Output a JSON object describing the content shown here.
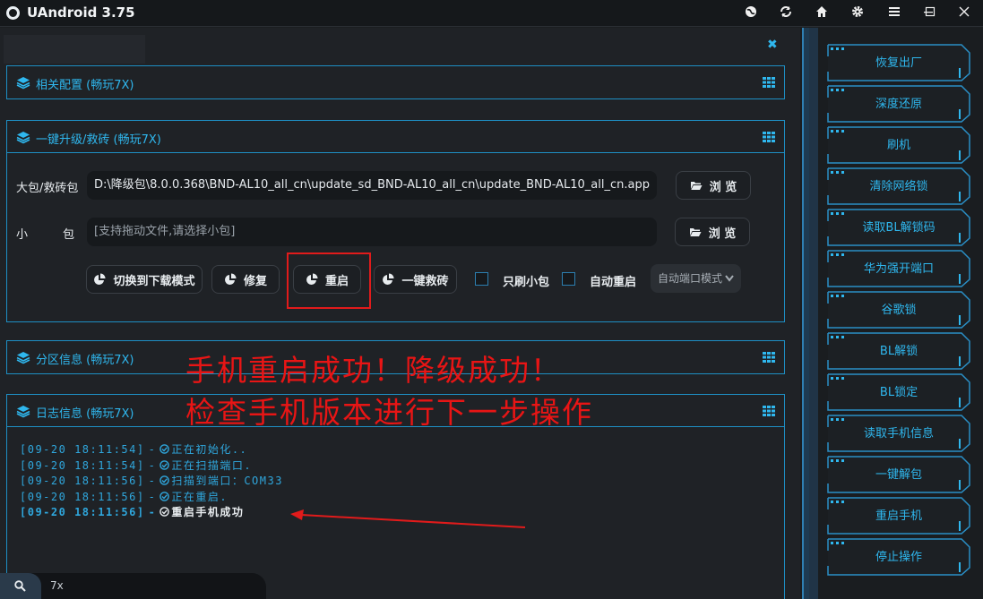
{
  "app": {
    "title": "UAndroid 3.75"
  },
  "titlebar_icons": [
    "globe-icon",
    "refresh-icon",
    "home-icon",
    "gear-icon",
    "menu-icon",
    "minimize-icon",
    "maximize-icon",
    "close-icon"
  ],
  "sections": {
    "config": {
      "title": "相关配置 (畅玩7X)"
    },
    "upgrade": {
      "title": "一键升级/救砖 (畅玩7X)",
      "big_pkg_label": "大包/救砖包",
      "big_pkg_value": "D:\\降级包\\8.0.0.368\\BND-AL10_all_cn\\update_sd_BND-AL10_all_cn\\update_BND-AL10_all_cn.app",
      "small_pkg_label_1": "小",
      "small_pkg_label_2": "包",
      "small_pkg_placeholder": "[支持拖动文件,请选择小包]",
      "browse_label": "浏 览",
      "btn_download_mode": "切换到下载模式",
      "btn_repair": "修复",
      "btn_reboot": "重启",
      "btn_unbrick": "一键救砖",
      "chk_small_only": "只刷小包",
      "chk_auto_reboot": "自动重启",
      "port_mode": "自动端口模式"
    },
    "partition": {
      "title": "分区信息 (畅玩7X)"
    },
    "log": {
      "title": "日志信息 (畅玩7X)",
      "lines": [
        {
          "time": "[09-20 18:11:54]",
          "sep": "-",
          "msg": "正在初始化.."
        },
        {
          "time": "[09-20 18:11:54]",
          "sep": "-",
          "msg": "正在扫描端口."
        },
        {
          "time": "[09-20 18:11:56]",
          "sep": "-",
          "msg": "扫描到端口：COM33"
        },
        {
          "time": "[09-20 18:11:56]",
          "sep": "-",
          "msg": "正在重启."
        },
        {
          "time": "[09-20 18:11:56]",
          "sep": "-",
          "msg": "重启手机成功"
        }
      ]
    }
  },
  "overlay": {
    "line1": "手机重启成功！降级成功！",
    "line2": "检查手机版本进行下一步操作"
  },
  "search": {
    "value": "7x"
  },
  "side_buttons": [
    "恢复出厂",
    "深度还原",
    "刷机",
    "清除网络锁",
    "读取BL解锁码",
    "华为强开端口",
    "谷歌锁",
    "BL解锁",
    "BL锁定",
    "读取手机信息",
    "一键解包",
    "重启手机",
    "停止操作"
  ],
  "colors": {
    "accent": "#2fb7ee",
    "annotation": "#e11b1b",
    "border": "#1e8fc4"
  }
}
